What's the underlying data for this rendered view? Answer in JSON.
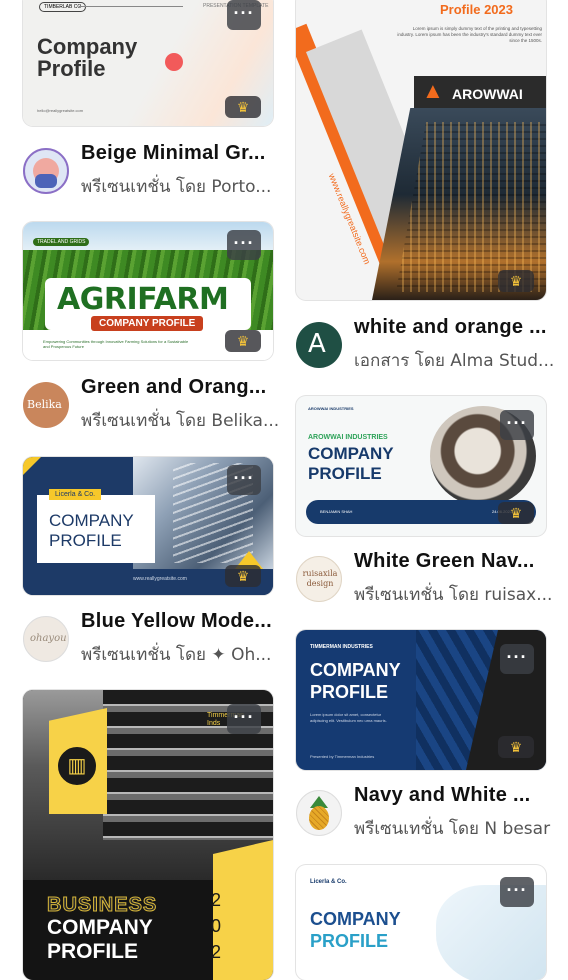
{
  "left_column": [
    {
      "thumb": {
        "top_chip": "TIMBERLAB CO",
        "top_right": "PRESENTATION TEMPLATE",
        "line1": "Company",
        "line2": "Profile",
        "email": "hello@reallygreatsite.com"
      },
      "title": "Beige Minimal Gr...",
      "subtitle": "พรีเซนเทชั่น โดย Porto..."
    },
    {
      "thumb": {
        "tag": "TRADEL AND GRIDS",
        "brand": "AGRIFARM",
        "ribbon": "COMPANY PROFILE",
        "tagline": "Empowering Communities through Innovative Farming Solutions for a Sustainable and Prosperous Future"
      },
      "avatar_text": "Belika",
      "title": "Green and Orang...",
      "subtitle": "พรีเซนเทชั่น โดย Belika..."
    },
    {
      "thumb": {
        "chip": "Licerla & Co.",
        "line1": "COMPANY",
        "line2": "PROFILE",
        "url": "www.reallygreatsite.com"
      },
      "avatar_text": "ohayou",
      "title": "Blue Yellow Mode...",
      "subtitle": "พรีเซนเทชั่น โดย ✦ Oh..."
    },
    {
      "thumb": {
        "corner": "Timmerman Inds",
        "line1": "BUSINESS",
        "line2": "COMPANY",
        "line3": "PROFILE",
        "year_digits": [
          "2",
          "0",
          "2"
        ]
      }
    }
  ],
  "right_column": [
    {
      "thumb": {
        "heading": "Profile 2023",
        "body": "Lorem ipsum is simply dummy text of the printing and typesetting industry. Lorem ipsum has been the industry's standard dummy text ever since the 1500s.",
        "brand": "AROWWAI",
        "url": "www.reallygreatsite.com"
      },
      "title": "white and orange ...",
      "subtitle": "เอกสาร โดย Alma Stud..."
    },
    {
      "thumb": {
        "brand": "AROWWAI INDUSTRIES",
        "sub_heading": "AROWWAI INDUSTRIES",
        "line1": "COMPANY",
        "line2": "PROFILE",
        "presenter": "BENJAMIN SHAH",
        "date": "24.06.2023"
      },
      "avatar_text": "ruisaxila design",
      "title": "White Green Nav...",
      "subtitle": "พรีเซนเทชั่น โดย ruisax..."
    },
    {
      "thumb": {
        "brand": "TIMMERMAN INDUSTRIES",
        "line1": "COMPANY",
        "line2": "PROFILE",
        "body": "Lorem ipsum dolor sit amet, consectetur adipiscing elit. Vestibulum nec urna mauris.",
        "presenter": "Presented by Timmerman Industries"
      },
      "title": "Navy and White ...",
      "subtitle": "พรีเซนเทชั่น โดย N besar"
    },
    {
      "thumb": {
        "chip": "Licerla & Co.",
        "line1": "COMPANY",
        "line2": "PROFILE"
      }
    }
  ],
  "icons": {
    "more": "more-options-icon",
    "premium": "crown-icon"
  },
  "colors": {
    "orange": "#f26b1d",
    "navy": "#173a6b",
    "green": "#2f8a2a",
    "yellow": "#f7d248"
  }
}
